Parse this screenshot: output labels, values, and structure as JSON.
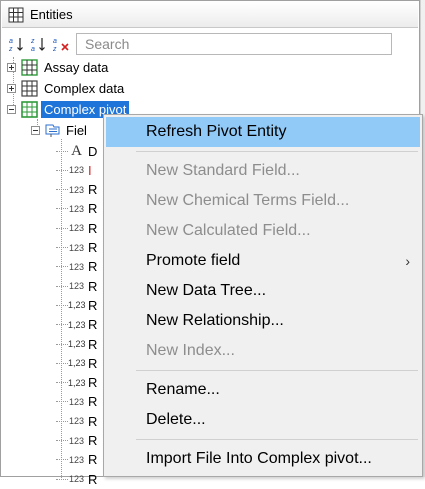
{
  "panel": {
    "title": "Entities",
    "icon": "grid-table-icon"
  },
  "toolbar": {
    "sort_asc_icon": "sort-az-icon",
    "sort_desc_icon": "sort-za-icon",
    "clear_sort_icon": "clear-sort-icon",
    "search_placeholder": "Search"
  },
  "tree": {
    "items": [
      {
        "label": "Assay data",
        "expander": "+",
        "icon": "grid-table-icon"
      },
      {
        "label": "Complex data",
        "expander": "+",
        "icon": "grid-table-icon"
      },
      {
        "label": "Complex pivot",
        "expander": "-",
        "icon": "grid-table-green-icon",
        "selected": true
      }
    ],
    "fields_node": {
      "label": "Fiel",
      "icon": "fields-folder-icon"
    },
    "fields": [
      {
        "type": "A",
        "name": "D"
      },
      {
        "type": "123",
        "name": "I",
        "name_color": "#cc2222"
      },
      {
        "type": "123",
        "name": "R"
      },
      {
        "type": "123",
        "name": "R"
      },
      {
        "type": "123",
        "name": "R"
      },
      {
        "type": "123",
        "name": "R"
      },
      {
        "type": "123",
        "name": "R"
      },
      {
        "type": "123",
        "name": "R"
      },
      {
        "type": "1,23",
        "name": "R"
      },
      {
        "type": "1,23",
        "name": "R"
      },
      {
        "type": "1,23",
        "name": "R"
      },
      {
        "type": "1,23",
        "name": "R"
      },
      {
        "type": "1,23",
        "name": "R"
      },
      {
        "type": "123",
        "name": "R"
      },
      {
        "type": "123",
        "name": "R"
      },
      {
        "type": "123",
        "name": "R"
      },
      {
        "type": "123",
        "name": "R"
      },
      {
        "type": "123",
        "name": "R"
      }
    ]
  },
  "context_menu": {
    "items": [
      {
        "label": "Refresh Pivot Entity",
        "highlighted": true
      },
      {
        "separator": true
      },
      {
        "label": "New Standard Field...",
        "disabled": true
      },
      {
        "label": "New Chemical Terms Field...",
        "disabled": true
      },
      {
        "label": "New Calculated Field...",
        "disabled": true
      },
      {
        "label": "Promote field",
        "submenu_arrow": "›"
      },
      {
        "label": "New Data Tree..."
      },
      {
        "label": "New Relationship..."
      },
      {
        "label": "New Index...",
        "disabled": true
      },
      {
        "separator": true
      },
      {
        "label": "Rename..."
      },
      {
        "label": "Delete..."
      },
      {
        "separator": true
      },
      {
        "label": "Import File Into Complex pivot..."
      }
    ]
  },
  "colors": {
    "selection": "#1e74d8",
    "menu_highlight": "#91c9f7",
    "grid_green": "#2e9a3a"
  }
}
